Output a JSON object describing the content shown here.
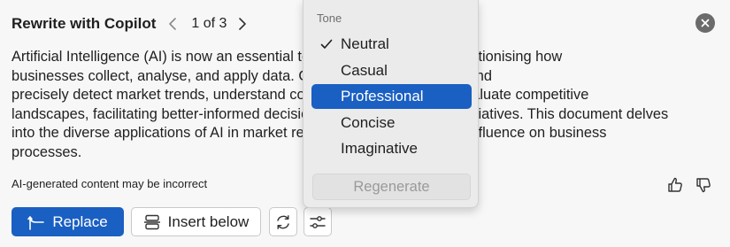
{
  "header": {
    "title": "Rewrite with Copilot",
    "pager": "1 of 3"
  },
  "body": {
    "lines": [
      "Artificial Intelligence (AI) is now an essential tool for data analysis, revolutionising how",
      "businesses collect, analyse, and apply data. Organisations can quickly and",
      "precisely detect market trends, understand consumer behaviour, and evaluate competitive",
      "landscapes, facilitating better-informed decision-making and strategic initiatives. This document delves",
      "into the diverse applications of AI in market research and its significant influence on business",
      "processes."
    ]
  },
  "footer": {
    "disclaimer": "AI-generated content may be incorrect"
  },
  "actions": {
    "replace_label": "Replace",
    "insert_below_label": "Insert below"
  },
  "tone_menu": {
    "section_label": "Tone",
    "items": [
      {
        "label": "Neutral",
        "checked": true
      },
      {
        "label": "Casual",
        "checked": false
      },
      {
        "label": "Professional",
        "checked": false
      },
      {
        "label": "Concise",
        "checked": false
      },
      {
        "label": "Imaginative",
        "checked": false
      }
    ],
    "highlighted": "Professional",
    "regenerate_label": "Regenerate"
  },
  "colors": {
    "accent": "#1a5fc2",
    "background": "#f7f7f7",
    "menu_background": "#ebebeb",
    "close_button": "#6b6b6b"
  },
  "icons": {
    "prev": "chevron-left-icon",
    "next": "chevron-right-icon",
    "close": "close-icon",
    "thumb_up": "thumb-up-icon",
    "thumb_down": "thumb-down-icon",
    "replace": "replace-arrow-icon",
    "insert_below": "insert-below-icon",
    "refresh": "refresh-icon",
    "tune": "tune-sliders-icon",
    "check": "checkmark-icon"
  }
}
